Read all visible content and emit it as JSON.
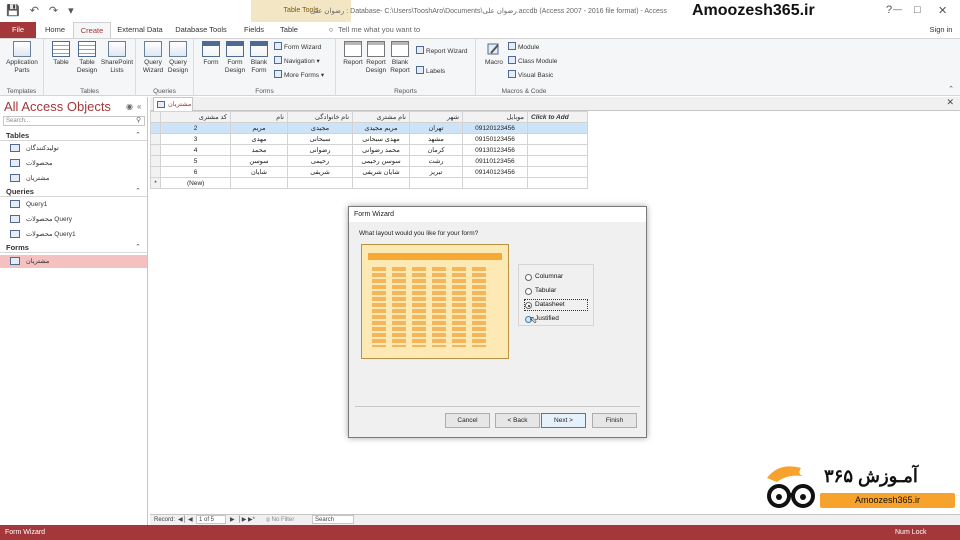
{
  "window": {
    "contextual_tab": "Table Tools",
    "title": "رضوان علی : Database- C:\\Users\\TooshAro\\Documents\\رضوان علی.accdb (Access 2007 - 2016 file format) - Access",
    "watermark": "Amoozesh365.ir",
    "signin": "Sign in",
    "tell_me": "Tell me what you want to do"
  },
  "tabs": [
    "File",
    "Home",
    "Create",
    "External Data",
    "Database Tools",
    "Fields",
    "Table"
  ],
  "ribbon": {
    "templates": {
      "label": "Templates",
      "app_parts": "Application Parts"
    },
    "tables": {
      "label": "Tables",
      "table": "Table",
      "table_design": "Table Design",
      "sharepoint": "SharePoint Lists"
    },
    "queries": {
      "label": "Queries",
      "wizard": "Query Wizard",
      "design": "Query Design"
    },
    "forms": {
      "label": "Forms",
      "form": "Form",
      "design": "Form Design",
      "blank": "Blank Form",
      "wizard": "Form Wizard",
      "navigation": "Navigation",
      "more": "More Forms"
    },
    "reports": {
      "label": "Reports",
      "report": "Report",
      "design": "Report Design",
      "blank": "Blank Report",
      "wizard": "Report Wizard",
      "labels": "Labels"
    },
    "macros": {
      "label": "Macros & Code",
      "macro": "Macro",
      "module": "Module",
      "class_module": "Class Module",
      "vb": "Visual Basic"
    }
  },
  "nav": {
    "title": "All Access Objects",
    "search": "Search...",
    "tables_hdr": "Tables",
    "tables": [
      "تولیدکنندگان",
      "محصولات",
      "مشتریان"
    ],
    "queries_hdr": "Queries",
    "queries": [
      "Query1",
      "محصولات Query",
      "محصولات Query1"
    ],
    "forms_hdr": "Forms",
    "forms": [
      "مشتریان"
    ]
  },
  "doc": {
    "tab": "مشتریان"
  },
  "grid": {
    "headers": [
      "کد مشتری",
      "نام",
      "نام خانوادگی",
      "نام مشتری",
      "شهر",
      "موبایل",
      "Click to Add"
    ],
    "rows": [
      [
        "2",
        "مریم",
        "مجیدی",
        "مریم مجیدی",
        "تهران",
        "09120123456"
      ],
      [
        "3",
        "مهدی",
        "سبحانی",
        "مهدی سبحانی",
        "مشهد",
        "09150123456"
      ],
      [
        "4",
        "محمد",
        "رضوانی",
        "محمد رضوانی",
        "کرمان",
        "09130123456"
      ],
      [
        "5",
        "سوسن",
        "رحیمی",
        "سوسن رحیمی",
        "رشت",
        "09110123456"
      ],
      [
        "6",
        "شایان",
        "شریفی",
        "شایان شریفی",
        "تبریز",
        "09140123456"
      ]
    ],
    "new_row": "(New)",
    "new_marker": "*"
  },
  "recnav": {
    "label": "Record:",
    "position": "1 of 5",
    "filter": "No Filter",
    "search": "Search"
  },
  "dialog": {
    "title": "Form Wizard",
    "question": "What layout would you like for your form?",
    "options": [
      "Columnar",
      "Tabular",
      "Datasheet",
      "Justified"
    ],
    "selected": "Datasheet",
    "buttons": {
      "cancel": "Cancel",
      "back": "< Back",
      "next": "Next >",
      "finish": "Finish"
    }
  },
  "status": {
    "left": "Form Wizard",
    "right": "Num Lock"
  },
  "logo": {
    "fa": "آمـوزش ۳۶۵",
    "en": "Amoozesh365.ir"
  }
}
